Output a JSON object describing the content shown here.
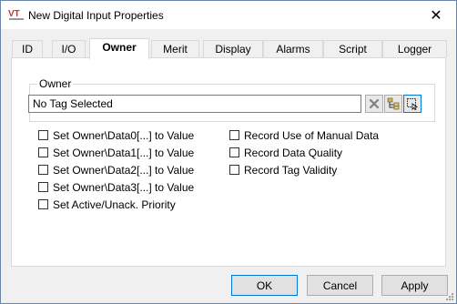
{
  "window": {
    "title": "New Digital Input Properties",
    "close_label": "✕"
  },
  "tabs": [
    {
      "label": "ID"
    },
    {
      "label": "I/O"
    },
    {
      "label": "Owner"
    },
    {
      "label": "Merit"
    },
    {
      "label": "Display"
    },
    {
      "label": "Alarms"
    },
    {
      "label": "Script"
    },
    {
      "label": "Logger"
    }
  ],
  "active_tab": "Owner",
  "owner": {
    "group_label": "Owner",
    "field_value": "No Tag Selected",
    "buttons": [
      {
        "icon": "clear-x-icon"
      },
      {
        "icon": "tag-browse-icon"
      },
      {
        "icon": "select-tag-icon"
      }
    ]
  },
  "options_left": [
    {
      "label": "Set Owner\\Data0[...] to Value",
      "checked": false
    },
    {
      "label": "Set Owner\\Data1[...] to Value",
      "checked": false
    },
    {
      "label": "Set Owner\\Data2[...] to Value",
      "checked": false
    },
    {
      "label": "Set Owner\\Data3[...] to Value",
      "checked": false
    },
    {
      "label": "Set Active/Unack. Priority",
      "checked": false
    }
  ],
  "options_right": [
    {
      "label": "Record Use of Manual Data",
      "checked": false
    },
    {
      "label": "Record Data Quality",
      "checked": false
    },
    {
      "label": "Record Tag Validity",
      "checked": false
    }
  ],
  "footer": {
    "ok_label": "OK",
    "cancel_label": "Cancel",
    "apply_label": "Apply"
  },
  "colors": {
    "accent": "#0078d7",
    "logo_red": "#c0392b"
  }
}
